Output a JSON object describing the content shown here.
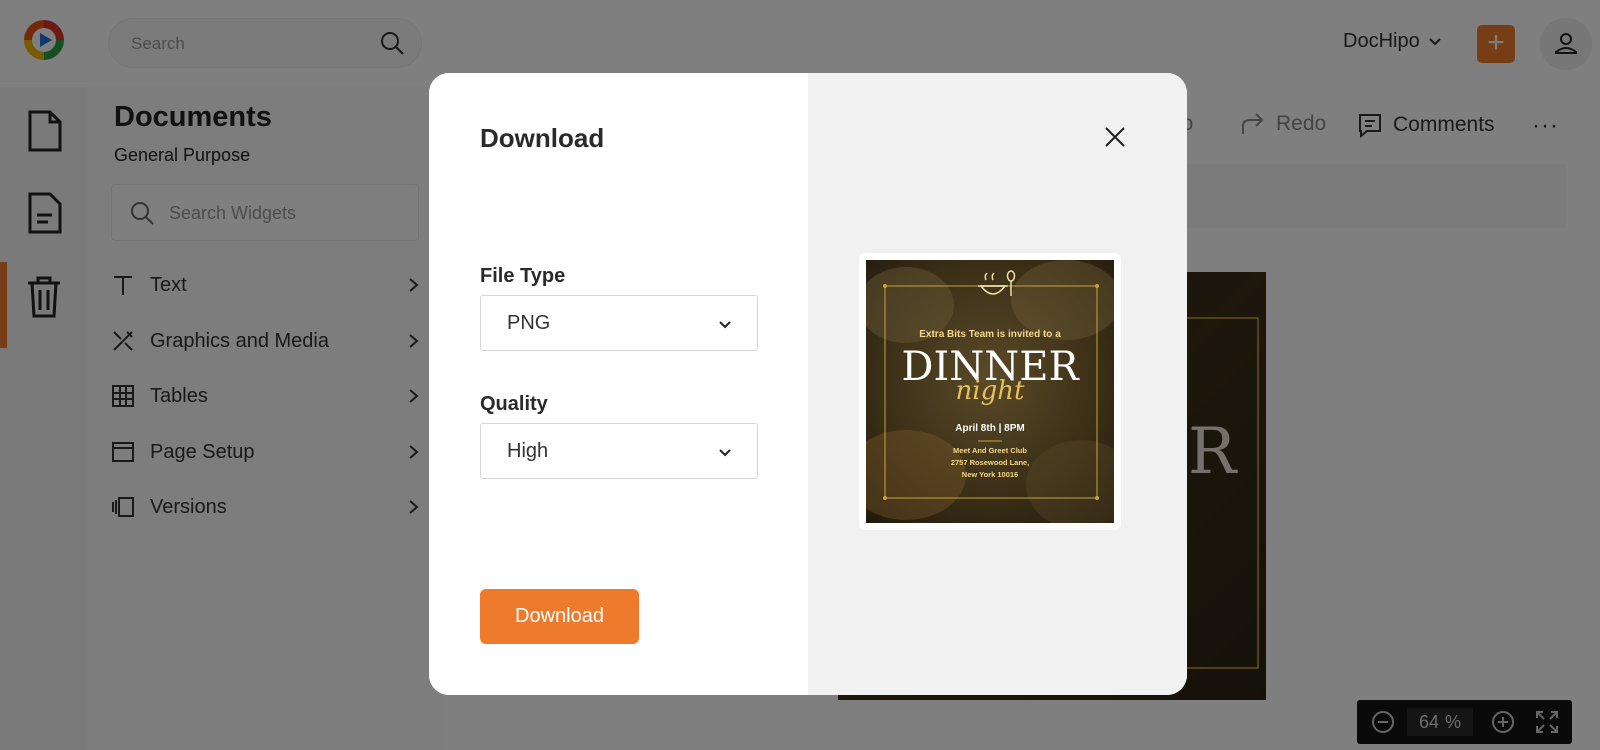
{
  "app": {
    "search_placeholder": "Search",
    "brand_menu": "DocHipo",
    "plus": "+"
  },
  "sidebar": {
    "title": "Documents",
    "subtitle": "General Purpose",
    "widget_search_placeholder": "Search Widgets",
    "items": [
      {
        "label": "Text",
        "icon": "text-icon"
      },
      {
        "label": "Graphics and Media",
        "icon": "graphics-icon"
      },
      {
        "label": "Tables",
        "icon": "table-icon"
      },
      {
        "label": "Page Setup",
        "icon": "page-setup-icon"
      },
      {
        "label": "Versions",
        "icon": "versions-icon"
      }
    ]
  },
  "toolbar": {
    "undo_fragment": "do",
    "redo": "Redo",
    "comments": "Comments",
    "more": "···"
  },
  "canvas": {
    "visible_letter": "R"
  },
  "zoom": {
    "value": "64",
    "unit": "%"
  },
  "modal": {
    "title": "Download",
    "file_type_label": "File Type",
    "file_type_value": "PNG",
    "quality_label": "Quality",
    "quality_value": "High",
    "download_button": "Download"
  },
  "preview": {
    "invite_line": "Extra Bits Team is invited to a",
    "title_main": "DINNER",
    "title_script": "night",
    "date_time": "April 8th | 8PM",
    "venue_line1": "Meet And Greet Club",
    "venue_line2": "2757 Rosewood Lane,",
    "venue_line3": "New York 10016"
  },
  "colors": {
    "accent": "#ee7a2c",
    "gold": "#c9a23a"
  }
}
